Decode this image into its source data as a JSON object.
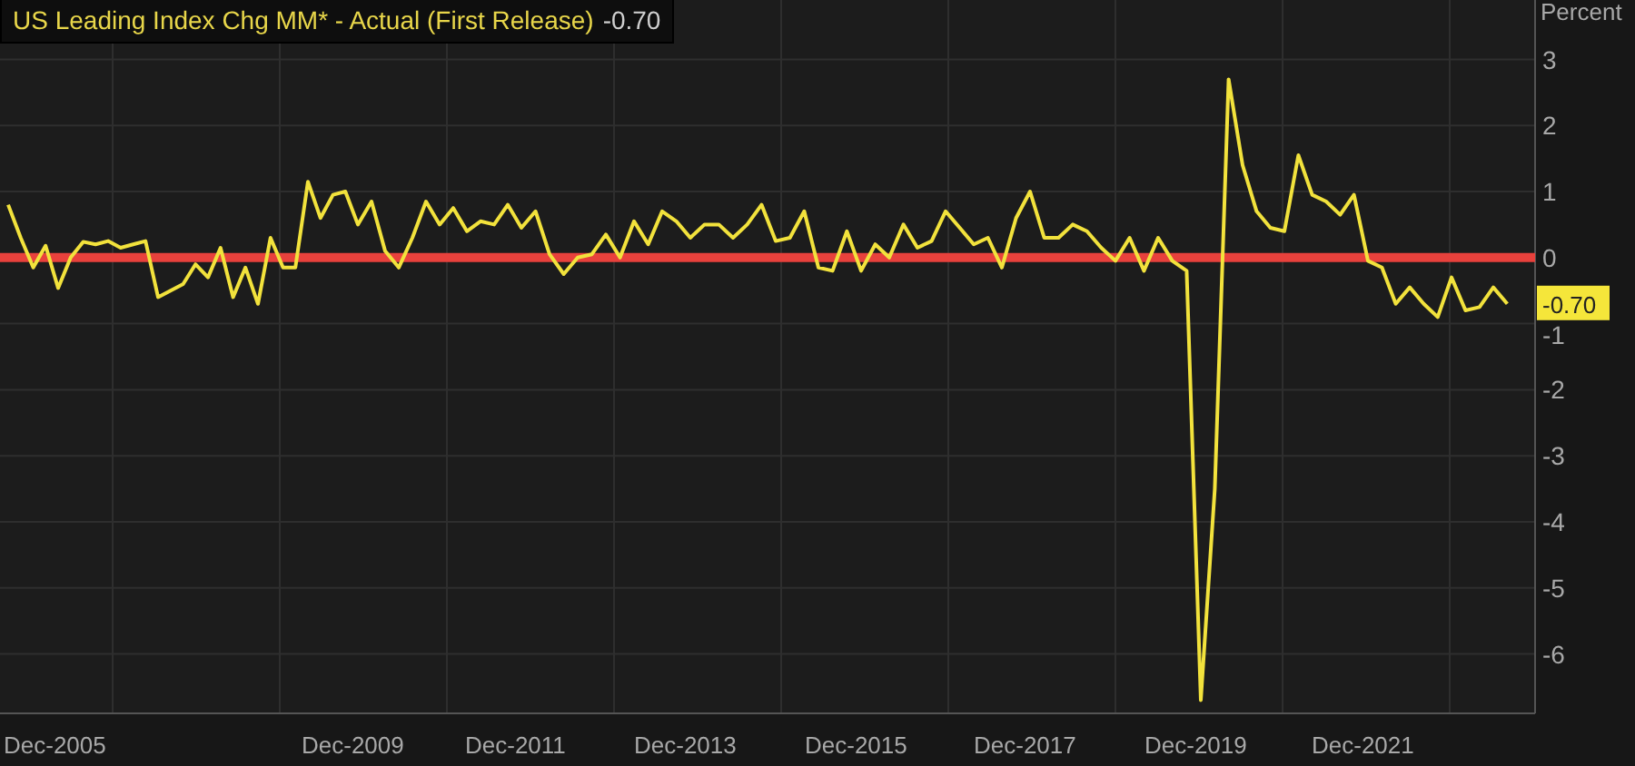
{
  "legend": {
    "value": "-0.70"
  },
  "chart_data": {
    "type": "line",
    "ylabel": "Percent",
    "ylim": [
      -6.9,
      3.9
    ],
    "grid": true,
    "categories": [
      null,
      null,
      null,
      null,
      "Dec-2005",
      null,
      null,
      null,
      null,
      null,
      null,
      null,
      null,
      null,
      null,
      null,
      null,
      null,
      null,
      null,
      null,
      null,
      null,
      null,
      null,
      null,
      null,
      null,
      "Dec-2009",
      null,
      null,
      null,
      null,
      null,
      null,
      null,
      null,
      null,
      null,
      null,
      "Dec-2011",
      null,
      null,
      null,
      null,
      null,
      null,
      null,
      null,
      null,
      null,
      null,
      "Dec-2013",
      null,
      null,
      null,
      null,
      null,
      null,
      null,
      null,
      null,
      null,
      null,
      "Dec-2015",
      null,
      null,
      null,
      null,
      null,
      null,
      null,
      null,
      null,
      null,
      null,
      "Dec-2017",
      null,
      null,
      null,
      null,
      null,
      null,
      null,
      null,
      null,
      null,
      null,
      "Dec-2019",
      null,
      null,
      null,
      null,
      null,
      null,
      null,
      null,
      null,
      null,
      null,
      "Dec-2021",
      null,
      null,
      null,
      null,
      null,
      null,
      null,
      null,
      null,
      null
    ],
    "series": [
      {
        "name": "US Leading Index Chg MM* - Actual (First Release)",
        "color": "#f2e23c",
        "values": [
          0.8,
          0.3,
          -0.15,
          0.18,
          -0.46,
          0.0,
          0.24,
          0.2,
          0.25,
          0.15,
          0.2,
          0.25,
          -0.6,
          -0.5,
          -0.4,
          -0.1,
          -0.3,
          0.15,
          -0.6,
          -0.15,
          -0.7,
          0.3,
          -0.15,
          -0.15,
          1.15,
          0.6,
          0.95,
          1.0,
          0.5,
          0.85,
          0.1,
          -0.15,
          0.3,
          0.85,
          0.5,
          0.75,
          0.4,
          0.55,
          0.5,
          0.8,
          0.45,
          0.7,
          0.05,
          -0.25,
          0.0,
          0.05,
          0.35,
          0.0,
          0.55,
          0.2,
          0.7,
          0.55,
          0.3,
          0.5,
          0.5,
          0.3,
          0.5,
          0.8,
          0.25,
          0.3,
          0.7,
          -0.15,
          -0.2,
          0.4,
          -0.2,
          0.2,
          0.0,
          0.5,
          0.15,
          0.25,
          0.7,
          0.45,
          0.2,
          0.3,
          -0.15,
          0.6,
          1.0,
          0.3,
          0.3,
          0.5,
          0.4,
          0.15,
          -0.05,
          0.3,
          -0.2,
          0.3,
          -0.05,
          -0.2,
          -6.7,
          -3.5,
          2.7,
          1.4,
          0.7,
          0.45,
          0.4,
          1.55,
          0.95,
          0.85,
          0.65,
          0.95,
          -0.05,
          -0.15,
          -0.7,
          -0.45,
          -0.7,
          -0.9,
          -0.3,
          -0.8,
          -0.75,
          -0.45,
          -0.7
        ]
      }
    ],
    "yticks": [
      3,
      2,
      1,
      0,
      -1,
      -2,
      -3,
      -4,
      -5,
      -6
    ],
    "ref_lines": [
      {
        "axis": "y",
        "value": 0,
        "color": "#e8413c"
      }
    ]
  },
  "last_value_label": "-0.70"
}
